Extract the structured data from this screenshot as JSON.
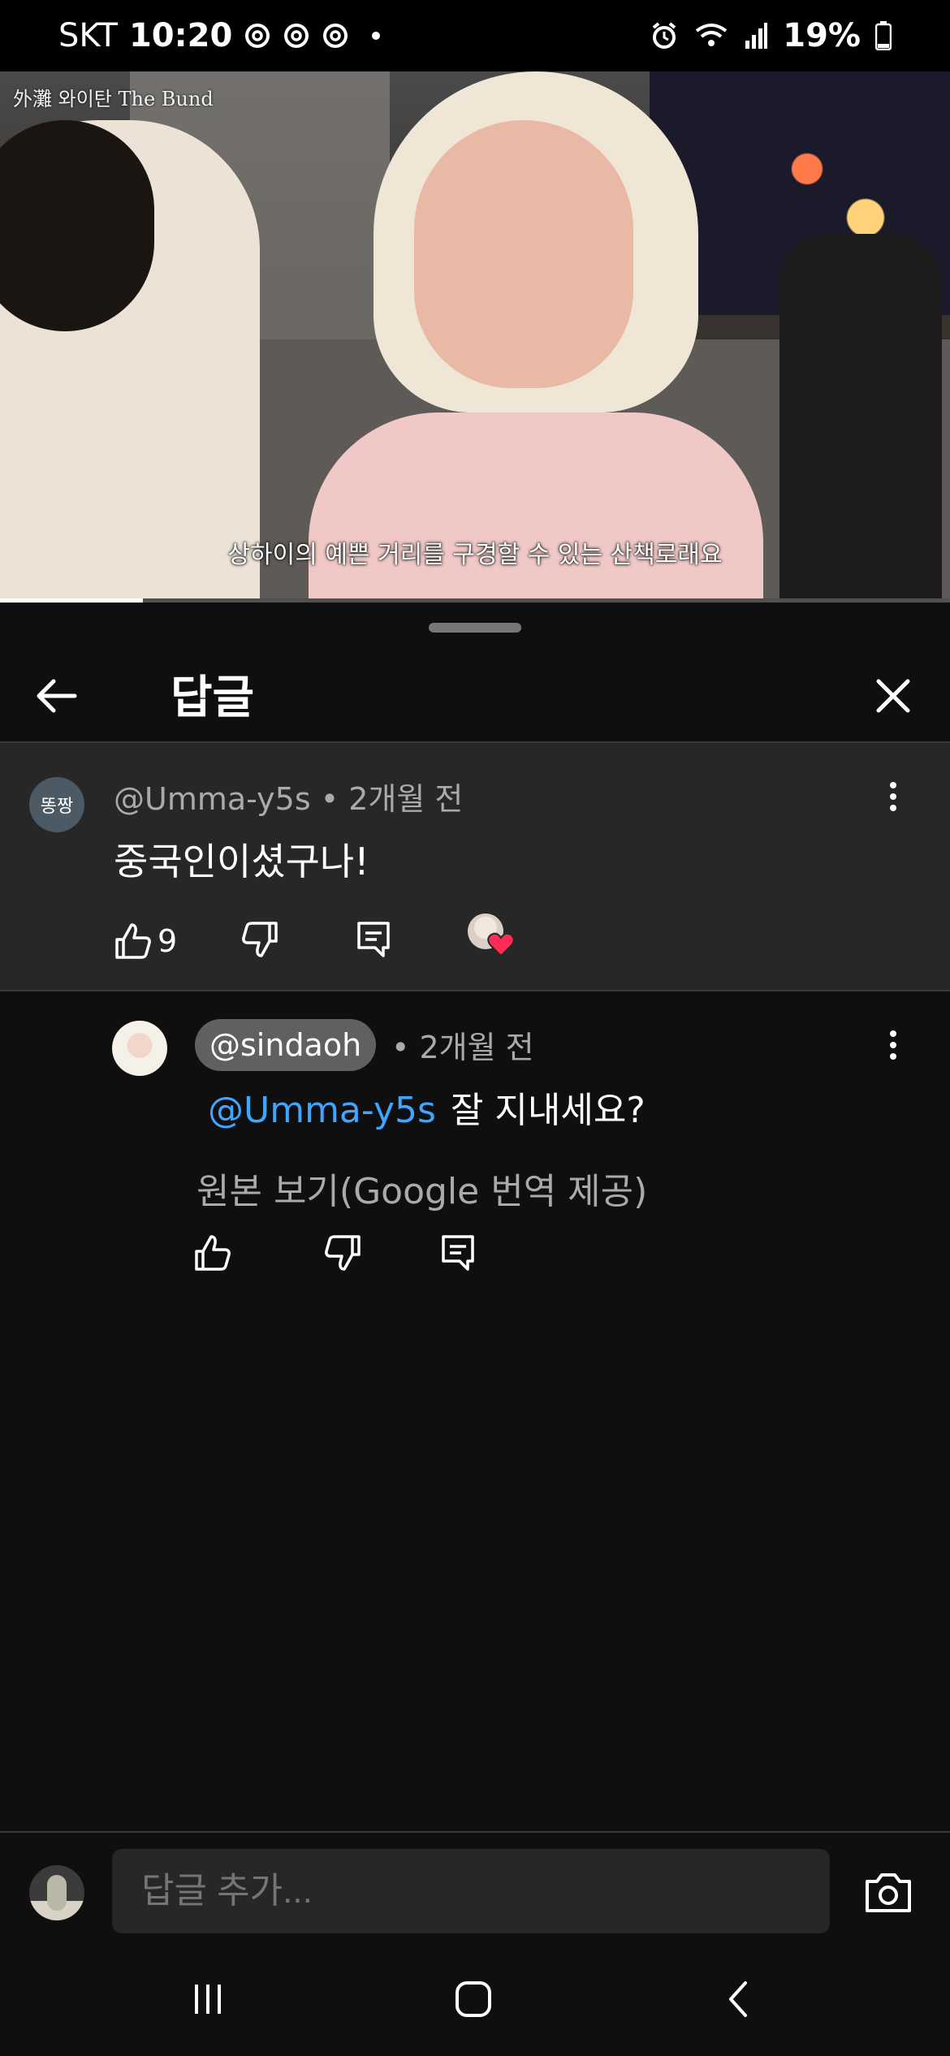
{
  "status_bar": {
    "carrier": "SKT",
    "time": "10:20",
    "battery": "19%"
  },
  "video": {
    "corner_caption": "外灘 와이탄 The Bund",
    "subtitle": "상하이의 예쁜 거리를 구경할 수 있는 산책로래요",
    "progress_fraction": 0.15
  },
  "sheet": {
    "title": "답글"
  },
  "parent_comment": {
    "avatar_text": "똥짱",
    "author": "@Umma-y5s",
    "time": "2개월 전",
    "text": "중국인이셨구나!",
    "like_count": "9"
  },
  "reply": {
    "author": "@sindaoh",
    "time": "2개월 전",
    "mention": "@Umma-y5s",
    "text": "잘 지내세요?",
    "see_original": "원본 보기(Google 번역 제공)"
  },
  "input": {
    "placeholder": "답글 추가..."
  },
  "colors": {
    "background": "#0f0f0f",
    "highlight_bg": "#272727",
    "mention": "#3ea6ff",
    "secondary_text": "#aaaaaa",
    "heart": "#ff2d55"
  }
}
